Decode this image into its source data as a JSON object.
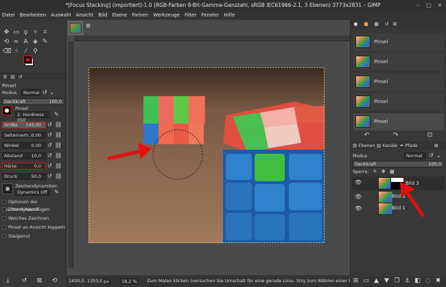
{
  "window": {
    "title": "*[Focus Stacking] (importiert)-1.0 (RGB-Farben 8-Bit-Gamma-Ganzzahl, sRGB IEC61966-2.1, 3 Ebenen) 3773x2831 – GIMP"
  },
  "menu": [
    "Datei",
    "Bearbeiten",
    "Auswahl",
    "Ansicht",
    "Bild",
    "Ebene",
    "Farben",
    "Werkzeuge",
    "Filter",
    "Fenster",
    "Hilfe"
  ],
  "tool_options": {
    "tool_name": "Pinsel",
    "mode_label": "Modus",
    "mode_value": "Normal",
    "opacity_label": "Deckkraft",
    "opacity_value": "100,0",
    "brush_label": "Pinsel",
    "brush_value": "2. Hardness 050",
    "size_label": "Größe",
    "size_value": "743,00",
    "aspect_label": "Seitenverh...",
    "aspect_value": "0,00",
    "angle_label": "Winkel",
    "angle_value": "0,00",
    "spacing_label": "Abstand",
    "spacing_value": "10,0",
    "hardness_label": "Härte",
    "hardness_value": "0,0",
    "force_label": "Druck",
    "force_value": "50,0",
    "dynamics_label": "Zeichendynamiken",
    "dynamics_value": "Dynamics Off",
    "checkboxes": [
      "Optionen der Zeichendynamik",
      "Zittern hinzufügen",
      "Weiches Zeichnen",
      "Pinsel an Ansicht koppeln",
      "Steigernd"
    ]
  },
  "history": {
    "items": [
      "Pinsel",
      "Pinsel",
      "Pinsel",
      "Pinsel",
      "Pinsel"
    ]
  },
  "layers_panel": {
    "tabs": [
      "Ebenen",
      "Kanäle",
      "Pfade"
    ],
    "mode_label": "Modus",
    "mode_value": "Normal",
    "opacity_label": "Deckkraft",
    "opacity_value": "100,0",
    "lock_label": "Sperre:",
    "layers": [
      "Bild 3",
      "Bild 2",
      "Bild 1"
    ]
  },
  "statusbar": {
    "coords": "1430,0, 1353,0",
    "unit": "px",
    "zoom": "18,2 %",
    "message": "Zum Malen klicken (versuchen Sie Umschalt für eine gerade Linie, Strg zum Wählen einer Farbe)"
  },
  "colors": {
    "annotation_red": "#e01010",
    "fg_color": "#e01010",
    "bg_color": "#ffffff"
  }
}
